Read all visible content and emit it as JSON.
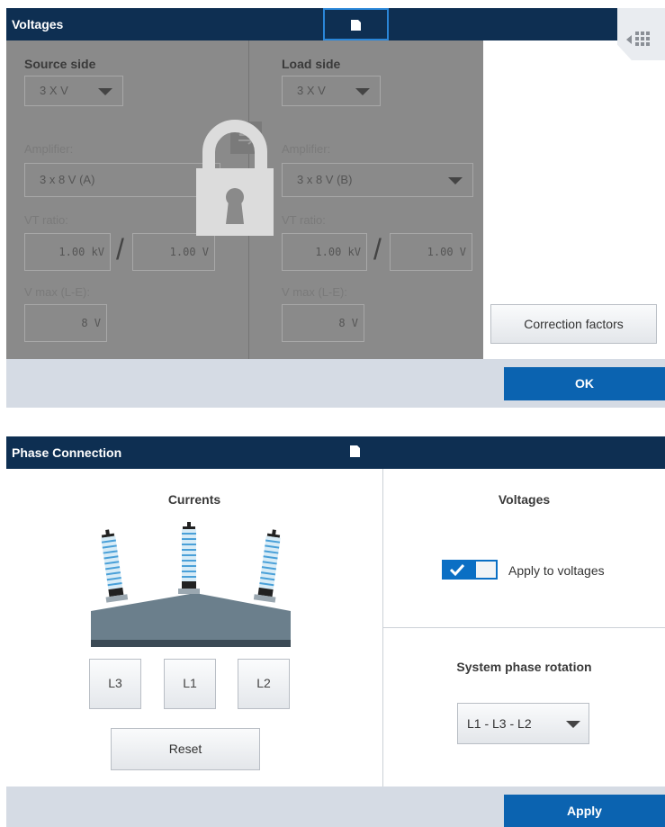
{
  "voltages": {
    "title": "Voltages",
    "source": {
      "heading": "Source side",
      "config": "3 X V",
      "amp_label": "Amplifier:",
      "amp_value": "3 x 8 V (A)",
      "vt_label": "VT ratio:",
      "vt_primary": "1.00 kV",
      "vt_secondary": "1.00 V",
      "vmax_label": "V max (L-E):",
      "vmax_value": "8 V"
    },
    "load": {
      "heading": "Load side",
      "config": "3 X V",
      "amp_label": "Amplifier:",
      "amp_value": "3 x 8 V (B)",
      "vt_label": "VT ratio:",
      "vt_primary": "1.00 kV",
      "vt_secondary": "1.00 V",
      "vmax_label": "V max (L-E):",
      "vmax_value": "8 V"
    },
    "slash": "/",
    "correction_label": "Correction factors",
    "ok_label": "OK",
    "locked": true
  },
  "phase": {
    "title": "Phase Connection",
    "currents_heading": "Currents",
    "terminals": [
      "L3",
      "L1",
      "L2"
    ],
    "reset_label": "Reset",
    "voltages_heading": "Voltages",
    "apply_to_voltages_label": "Apply to voltages",
    "apply_to_voltages_checked": true,
    "rotation_heading": "System phase rotation",
    "rotation_value": "L1 - L3 - L2",
    "apply_label": "Apply"
  },
  "colors": {
    "header": "#0e2f52",
    "primary": "#0b63b0",
    "footer": "#d5dbe4",
    "lock_overlay": "#8a8a8a"
  },
  "icons": [
    "notebook-icon",
    "collapse-panel-icon",
    "lock-icon",
    "swap-icon",
    "checkmark-icon",
    "chevron-down-icon"
  ]
}
